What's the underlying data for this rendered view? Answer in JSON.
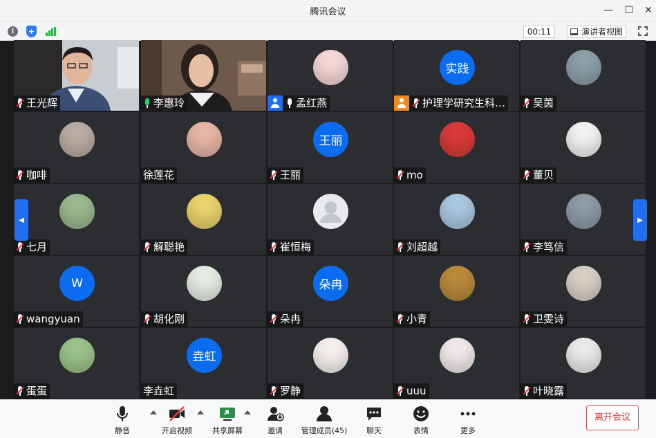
{
  "window": {
    "title": "腾讯会议"
  },
  "infobar": {
    "timer": "00:11",
    "view_label": "演讲者视图"
  },
  "participants": [
    {
      "name": "王光辉",
      "mic": "muted",
      "kind": "video-man"
    },
    {
      "name": "李惠玲",
      "mic": "on",
      "kind": "video-woman"
    },
    {
      "name": "孟红燕",
      "mic": "on-white",
      "badge": "host",
      "kind": "photo",
      "color": "#f6d6d6"
    },
    {
      "name": "护理学研究生科…",
      "mic": "muted",
      "badge": "cohost",
      "kind": "letter",
      "initials": "实践"
    },
    {
      "name": "吴茵",
      "mic": "muted",
      "kind": "photo",
      "color": "#8aa0a6"
    },
    {
      "name": "咖啡",
      "mic": "muted",
      "kind": "photo",
      "color": "#b9aca2"
    },
    {
      "name": "徐莲花",
      "mic": "none",
      "kind": "photo",
      "color": "#e7b6a5"
    },
    {
      "name": "王丽",
      "mic": "muted",
      "kind": "letter",
      "initials": "王丽"
    },
    {
      "name": "mo",
      "mic": "muted",
      "kind": "photo",
      "color": "#d93a3a"
    },
    {
      "name": "董贝",
      "mic": "muted",
      "kind": "photo",
      "color": "#f1f1f1"
    },
    {
      "name": "七月",
      "mic": "muted",
      "kind": "photo",
      "color": "#9bb88c"
    },
    {
      "name": "解聪艳",
      "mic": "muted",
      "kind": "photo",
      "color": "#e9d36c"
    },
    {
      "name": "崔恒梅",
      "mic": "muted",
      "kind": "default"
    },
    {
      "name": "刘超越",
      "mic": "muted",
      "kind": "photo",
      "color": "#a9c7e0"
    },
    {
      "name": "李笃信",
      "mic": "muted",
      "kind": "photo",
      "color": "#8c9ba6"
    },
    {
      "name": "wangyuan",
      "mic": "muted",
      "kind": "letter",
      "initials": "W"
    },
    {
      "name": "胡化刚",
      "mic": "muted",
      "kind": "photo",
      "color": "#e6ece3"
    },
    {
      "name": "朵冉",
      "mic": "muted",
      "kind": "letter",
      "initials": "朵冉"
    },
    {
      "name": "小青",
      "mic": "muted",
      "kind": "photo",
      "color": "#b88a3b"
    },
    {
      "name": "卫雯诗",
      "mic": "muted",
      "kind": "photo",
      "color": "#d6cfc4"
    },
    {
      "name": "蛋蛋",
      "mic": "muted",
      "kind": "photo",
      "color": "#9ac28a"
    },
    {
      "name": "李垚虹",
      "mic": "none",
      "kind": "letter",
      "initials": "垚虹"
    },
    {
      "name": "罗静",
      "mic": "muted",
      "kind": "photo",
      "color": "#f5f0ee"
    },
    {
      "name": "uuu",
      "mic": "muted",
      "kind": "photo",
      "color": "#efe8e8"
    },
    {
      "name": "叶晓露",
      "mic": "muted",
      "kind": "photo",
      "color": "#e9e9ea"
    }
  ],
  "toolbar": {
    "mute": "静音",
    "video": "开启视频",
    "share": "共享屏幕",
    "invite": "邀请",
    "members": "管理成员(45)",
    "chat": "聊天",
    "reactions": "表情",
    "more": "更多",
    "leave": "离开会议"
  },
  "colors": {
    "accent": "#1f6ff0",
    "active_speaker": "#27c14b",
    "danger": "#e33a3a"
  }
}
